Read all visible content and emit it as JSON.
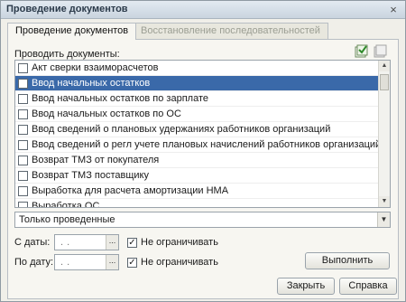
{
  "window": {
    "title": "Проведение документов",
    "close_glyph": "×"
  },
  "tabs": [
    {
      "label": "Проведение документов",
      "active": true
    },
    {
      "label": "Восстановление последовательностей",
      "active": false
    }
  ],
  "list": {
    "label": "Проводить документы:",
    "items": [
      {
        "label": "Акт сверки взаиморасчетов",
        "checked": false
      },
      {
        "label": "Ввод начальных остатков",
        "checked": false,
        "selected": true
      },
      {
        "label": "Ввод начальных остатков по зарплате",
        "checked": false
      },
      {
        "label": "Ввод начальных остатков по ОС",
        "checked": false
      },
      {
        "label": "Ввод сведений о плановых удержаниях работников организаций",
        "checked": false
      },
      {
        "label": "Ввод сведений о регл учете плановых начислений работников организаций",
        "checked": false
      },
      {
        "label": "Возврат ТМЗ от покупателя",
        "checked": false
      },
      {
        "label": "Возврат ТМЗ поставщику",
        "checked": false
      },
      {
        "label": "Выработка для расчета амортизации НМА",
        "checked": false
      },
      {
        "label": "Выработка ОС",
        "checked": false
      }
    ]
  },
  "icons": {
    "check_all": "check-all-icon",
    "uncheck_all": "uncheck-all-icon",
    "scroll_up": "▲",
    "scroll_down": "▼",
    "dropdown": "▼",
    "date_picker": "..."
  },
  "filter": {
    "value": "Только проведенные"
  },
  "from_date": {
    "label": "С даты:",
    "value": ". .",
    "no_limit_label": "Не ограничивать",
    "no_limit_checked": true
  },
  "to_date": {
    "label": "По дату:",
    "value": ". .",
    "no_limit_label": "Не ограничивать",
    "no_limit_checked": true
  },
  "buttons": {
    "run": "Выполнить",
    "close": "Закрыть",
    "help": "Справка"
  },
  "colors": {
    "selection": "#3a69a9",
    "window_bg": "#f0efe9",
    "title_text": "#2b3a4a"
  }
}
